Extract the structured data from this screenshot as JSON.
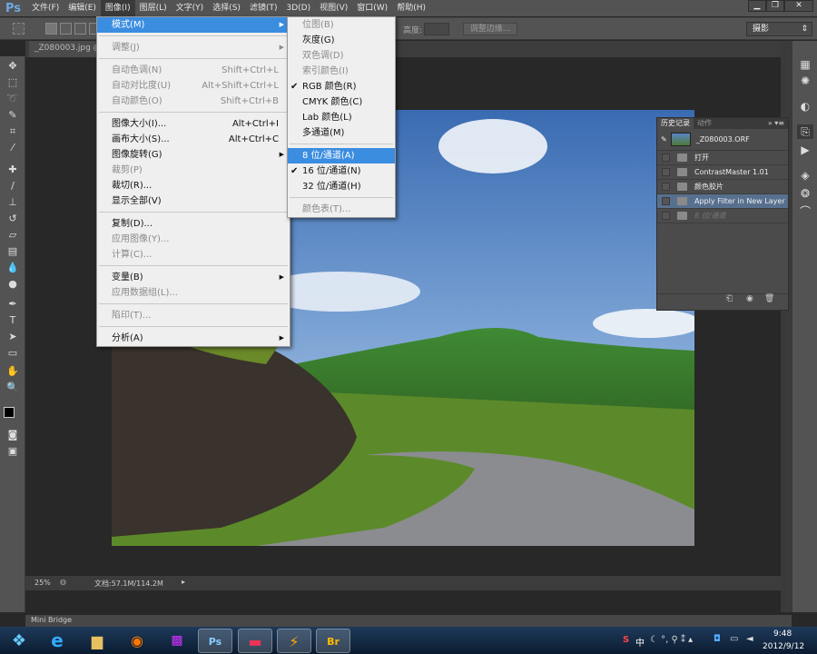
{
  "app": {
    "logo": "Ps"
  },
  "menubar": [
    "文件(F)",
    "编辑(E)",
    "图像(I)",
    "图层(L)",
    "文字(Y)",
    "选择(S)",
    "滤镜(T)",
    "3D(D)",
    "视图(V)",
    "窗口(W)",
    "帮助(H)"
  ],
  "window_controls": {
    "minimize": "▁",
    "restore": "❐",
    "close": "✕"
  },
  "options": {
    "height_label": "高度:",
    "refine_edge": "调整边缘...",
    "workspace": "摄影"
  },
  "document": {
    "tab": "_Z080003.jpg @ 25%",
    "zoom": "25%",
    "doc_info": "文档:57.1M/114.2M"
  },
  "image_menu": [
    {
      "label": "模式(M)",
      "state": "highlight",
      "submenu": true
    },
    {
      "sep": true
    },
    {
      "label": "调整(J)",
      "state": "disabled",
      "submenu": true
    },
    {
      "sep": true
    },
    {
      "label": "自动色调(N)",
      "shortcut": "Shift+Ctrl+L",
      "state": "disabled"
    },
    {
      "label": "自动对比度(U)",
      "shortcut": "Alt+Shift+Ctrl+L",
      "state": "disabled"
    },
    {
      "label": "自动颜色(O)",
      "shortcut": "Shift+Ctrl+B",
      "state": "disabled"
    },
    {
      "sep": true
    },
    {
      "label": "图像大小(I)...",
      "shortcut": "Alt+Ctrl+I",
      "state": "enabled"
    },
    {
      "label": "画布大小(S)...",
      "shortcut": "Alt+Ctrl+C",
      "state": "enabled"
    },
    {
      "label": "图像旋转(G)",
      "state": "enabled",
      "submenu": true
    },
    {
      "label": "裁剪(P)",
      "state": "disabled"
    },
    {
      "label": "裁切(R)...",
      "state": "enabled"
    },
    {
      "label": "显示全部(V)",
      "state": "enabled"
    },
    {
      "sep": true
    },
    {
      "label": "复制(D)...",
      "state": "enabled"
    },
    {
      "label": "应用图像(Y)...",
      "state": "disabled"
    },
    {
      "label": "计算(C)...",
      "state": "disabled"
    },
    {
      "sep": true
    },
    {
      "label": "变量(B)",
      "state": "enabled",
      "submenu": true
    },
    {
      "label": "应用数据组(L)...",
      "state": "disabled"
    },
    {
      "sep": true
    },
    {
      "label": "陷印(T)...",
      "state": "disabled"
    },
    {
      "sep": true
    },
    {
      "label": "分析(A)",
      "state": "enabled",
      "submenu": true
    }
  ],
  "mode_submenu": [
    {
      "label": "位图(B)",
      "state": "disabled"
    },
    {
      "label": "灰度(G)",
      "state": "enabled"
    },
    {
      "label": "双色调(D)",
      "state": "disabled"
    },
    {
      "label": "索引颜色(I)",
      "state": "disabled"
    },
    {
      "label": "RGB 颜色(R)",
      "state": "enabled",
      "checked": true
    },
    {
      "label": "CMYK 颜色(C)",
      "state": "enabled"
    },
    {
      "label": "Lab 颜色(L)",
      "state": "enabled"
    },
    {
      "label": "多通道(M)",
      "state": "enabled"
    },
    {
      "sep": true
    },
    {
      "label": "8 位/通道(A)",
      "state": "highlight"
    },
    {
      "label": "16 位/通道(N)",
      "state": "enabled",
      "checked": true
    },
    {
      "label": "32 位/通道(H)",
      "state": "enabled"
    },
    {
      "sep": true
    },
    {
      "label": "颜色表(T)...",
      "state": "disabled"
    }
  ],
  "history_panel": {
    "tabs": [
      "历史记录",
      "动作"
    ],
    "snapshot": "_Z080003.ORF",
    "items": [
      {
        "label": "打开",
        "state": "normal"
      },
      {
        "label": "ContrastMaster 1.01",
        "state": "normal"
      },
      {
        "label": "颜色胶片",
        "state": "normal"
      },
      {
        "label": "Apply Filter in New Layer",
        "state": "selected"
      },
      {
        "label": "8 位/通道",
        "state": "dim"
      }
    ]
  },
  "mini_bridge": "Mini Bridge",
  "taskbar": {
    "apps": [
      "Ps",
      "Br"
    ],
    "time": "9:48",
    "date": "2012/9/12",
    "ime": "中"
  },
  "colors": {
    "menu_highlight": "#3b8de0",
    "history_selected": "#58708f"
  }
}
